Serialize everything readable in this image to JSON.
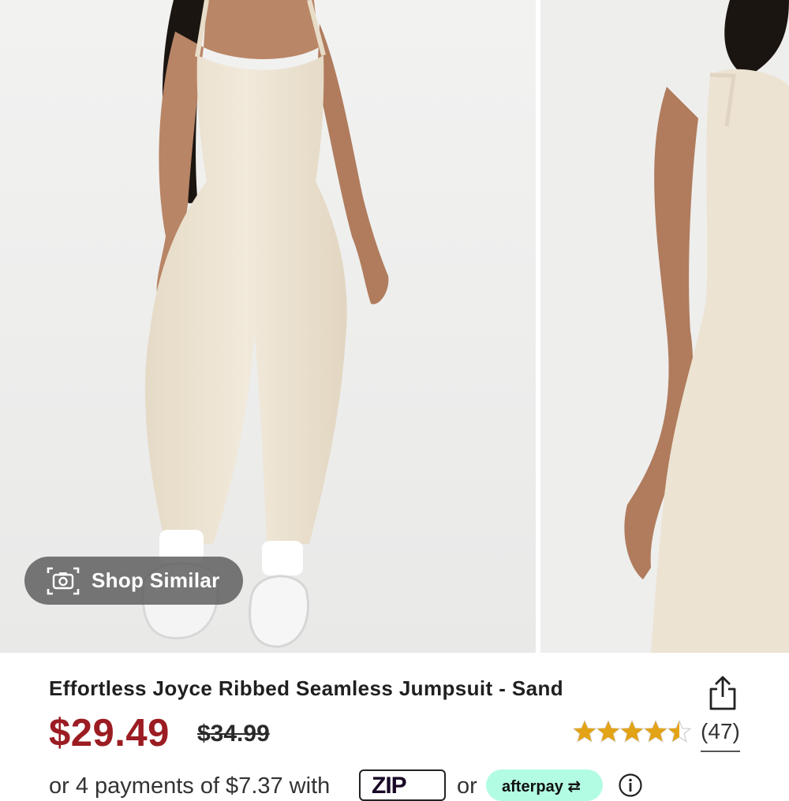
{
  "shop_similar": {
    "label": "Shop Similar",
    "icon": "camera-icon"
  },
  "product": {
    "title": "Effortless Joyce Ribbed Seamless Jumpsuit - Sand",
    "price": "$29.49",
    "original_price": "$34.99",
    "rating_stars": 4.5,
    "rating_max": 5,
    "review_count": "(47)"
  },
  "payments": {
    "installment_text": "or 4 payments of $7.37 with",
    "zip_label": "ZIP",
    "or_text": "or",
    "afterpay_label": "afterpay"
  },
  "icons": {
    "share": "share-icon",
    "star": "star-icon",
    "info": "info-icon"
  },
  "colors": {
    "price": "#9b1c22",
    "star": "#e3a316",
    "afterpay": "#b2fce4",
    "garment": "#ede4d3"
  }
}
